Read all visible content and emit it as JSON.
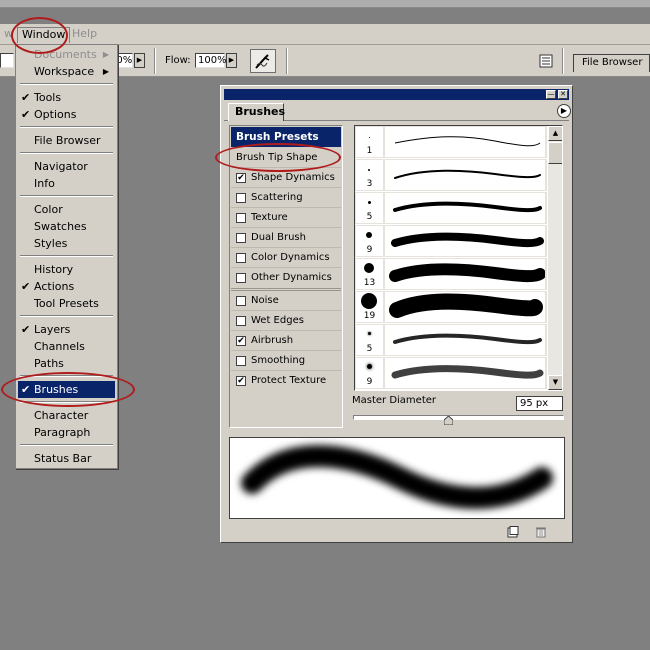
{
  "menubar": {
    "window_label": "Window",
    "help_label": "Help",
    "partial_left": "w"
  },
  "options_bar": {
    "opacity_value": "00%",
    "flow_label": "Flow:",
    "flow_value": "100%",
    "airbrush_icon": "airbrush-icon",
    "file_browser_tab": "File Browser"
  },
  "window_menu": {
    "items": [
      {
        "label": "Documents",
        "checked": false,
        "submenu": true,
        "disabled": true
      },
      {
        "label": "Workspace",
        "checked": false,
        "submenu": true,
        "disabled": false
      },
      {
        "label": "Tools",
        "checked": true
      },
      {
        "label": "Options",
        "checked": true
      },
      {
        "label": "File Browser",
        "checked": false
      },
      {
        "label": "Navigator",
        "checked": false
      },
      {
        "label": "Info",
        "checked": false
      },
      {
        "label": "Color",
        "checked": false
      },
      {
        "label": "Swatches",
        "checked": false
      },
      {
        "label": "Styles",
        "checked": false
      },
      {
        "label": "History",
        "checked": false
      },
      {
        "label": "Actions",
        "checked": true
      },
      {
        "label": "Tool Presets",
        "checked": false
      },
      {
        "label": "Layers",
        "checked": true
      },
      {
        "label": "Channels",
        "checked": false
      },
      {
        "label": "Paths",
        "checked": false
      },
      {
        "label": "Brushes",
        "checked": true,
        "selected": true
      },
      {
        "label": "Character",
        "checked": false
      },
      {
        "label": "Paragraph",
        "checked": false
      },
      {
        "label": "Status Bar",
        "checked": false
      }
    ]
  },
  "brushes_palette": {
    "tab_label": "Brushes",
    "presets_header": "Brush Presets",
    "brush_tip_shape": "Brush Tip Shape",
    "options": [
      {
        "label": "Shape Dynamics",
        "checked": true
      },
      {
        "label": "Scattering",
        "checked": false
      },
      {
        "label": "Texture",
        "checked": false
      },
      {
        "label": "Dual Brush",
        "checked": false
      },
      {
        "label": "Color Dynamics",
        "checked": false
      },
      {
        "label": "Other Dynamics",
        "checked": false
      },
      {
        "label": "Noise",
        "checked": false
      },
      {
        "label": "Wet Edges",
        "checked": false
      },
      {
        "label": "Airbrush",
        "checked": true
      },
      {
        "label": "Smoothing",
        "checked": false
      },
      {
        "label": "Protect Texture",
        "checked": true
      }
    ],
    "brush_sizes": [
      "1",
      "3",
      "5",
      "9",
      "13",
      "19",
      "5",
      "9"
    ],
    "master_diameter_label": "Master Diameter",
    "master_diameter_value": "95 px",
    "master_diameter_slider_fraction": 0.45
  },
  "annotations": {
    "highlight_color": "#b01c1c",
    "selection_color": "#0a246a"
  }
}
